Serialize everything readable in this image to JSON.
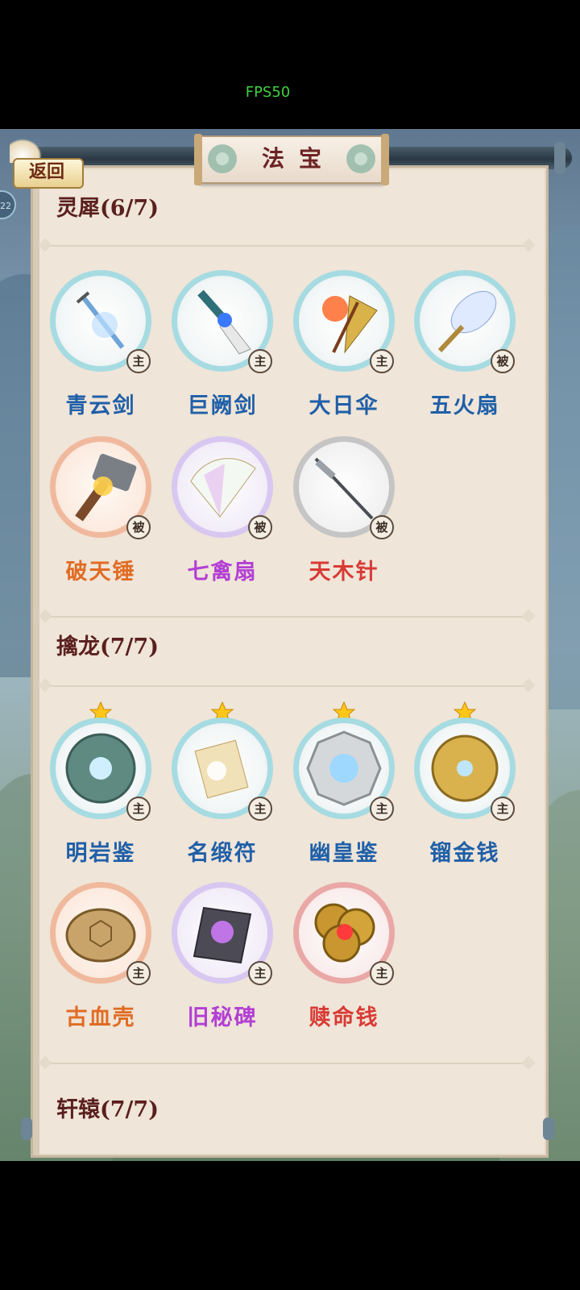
{
  "fps": "FPS50",
  "header": {
    "title": "法宝",
    "back_label": "返回",
    "side_badge": "22"
  },
  "sections": [
    {
      "title": "灵犀(6/7)",
      "items": [
        {
          "name": "青云剑",
          "tag": "主",
          "icon": "sword-icon",
          "color": "blue"
        },
        {
          "name": "巨阙剑",
          "tag": "主",
          "icon": "dagger-icon",
          "color": "blue"
        },
        {
          "name": "大日伞",
          "tag": "主",
          "icon": "umbrella-icon",
          "color": "blue"
        },
        {
          "name": "五火扇",
          "tag": "被",
          "icon": "feather-fan-icon",
          "color": "blue"
        },
        {
          "name": "破天锤",
          "tag": "被",
          "icon": "hammer-icon",
          "color": "orange"
        },
        {
          "name": "七禽扇",
          "tag": "被",
          "icon": "folding-fan-icon",
          "color": "purple"
        },
        {
          "name": "天木针",
          "tag": "被",
          "icon": "needle-icon",
          "color": "red"
        }
      ]
    },
    {
      "title": "擒龙(7/7)",
      "items": [
        {
          "name": "明岩鉴",
          "tag": "主",
          "icon": "jade-disc-icon",
          "color": "blue",
          "star": true
        },
        {
          "name": "名缎符",
          "tag": "主",
          "icon": "scroll-icon",
          "color": "blue",
          "star": true
        },
        {
          "name": "幽皇鉴",
          "tag": "主",
          "icon": "bagua-mirror-icon",
          "color": "blue",
          "star": true
        },
        {
          "name": "镏金钱",
          "tag": "主",
          "icon": "gold-coin-icon",
          "color": "blue",
          "star": true
        },
        {
          "name": "古血壳",
          "tag": "主",
          "icon": "turtle-shell-icon",
          "color": "orange"
        },
        {
          "name": "旧秘碑",
          "tag": "主",
          "icon": "stone-tablet-icon",
          "color": "purple"
        },
        {
          "name": "赎命钱",
          "tag": "主",
          "icon": "coins-icon",
          "color": "red"
        }
      ]
    },
    {
      "title": "轩辕(7/7)",
      "items": []
    }
  ]
}
